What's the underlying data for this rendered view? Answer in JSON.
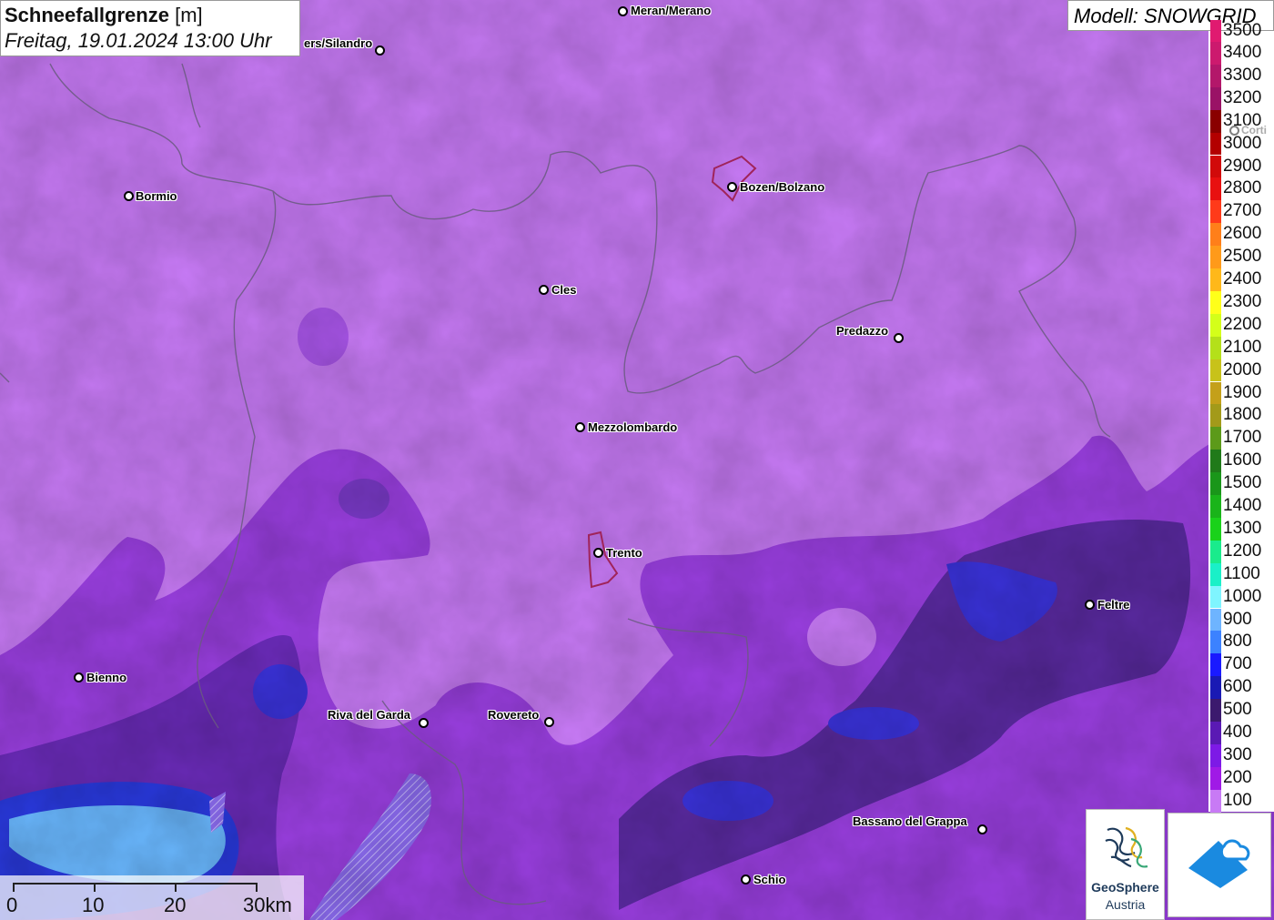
{
  "header": {
    "title_bold": "Schneefallgrenze",
    "title_unit": "[m]",
    "datetime": "Freitag, 19.01.2024 13:00 Uhr"
  },
  "model_label": "Modell: SNOWGRID",
  "legend": {
    "top_label_partial": "3500",
    "items": [
      {
        "label": "3400",
        "color": "#cc1a6e"
      },
      {
        "label": "3300",
        "color": "#b3176a"
      },
      {
        "label": "3200",
        "color": "#9a1266"
      },
      {
        "label": "3100",
        "color": "#8a0000"
      },
      {
        "label": "3000",
        "color": "#b30000"
      },
      {
        "label": "2900",
        "color": "#d10a0a"
      },
      {
        "label": "2800",
        "color": "#e81010"
      },
      {
        "label": "2700",
        "color": "#ff3a1a"
      },
      {
        "label": "2600",
        "color": "#ff7f1a"
      },
      {
        "label": "2500",
        "color": "#ff9a1a"
      },
      {
        "label": "2400",
        "color": "#ffb81a"
      },
      {
        "label": "2300",
        "color": "#ffff1a"
      },
      {
        "label": "2200",
        "color": "#d4ff1a"
      },
      {
        "label": "2100",
        "color": "#b4e01a"
      },
      {
        "label": "2000",
        "color": "#c8c21a"
      },
      {
        "label": "1900",
        "color": "#c4a01a"
      },
      {
        "label": "1800",
        "color": "#a39a1a"
      },
      {
        "label": "1700",
        "color": "#5c9a1a"
      },
      {
        "label": "1600",
        "color": "#207a1a"
      },
      {
        "label": "1500",
        "color": "#1a961a"
      },
      {
        "label": "1400",
        "color": "#1ab41a"
      },
      {
        "label": "1300",
        "color": "#1ad21a"
      },
      {
        "label": "1200",
        "color": "#1aeb8c"
      },
      {
        "label": "1100",
        "color": "#1af0c8"
      },
      {
        "label": "1000",
        "color": "#7ff5ff"
      },
      {
        "label": "900",
        "color": "#6eb4ff"
      },
      {
        "label": "800",
        "color": "#3c82ff"
      },
      {
        "label": "700",
        "color": "#1a1aff"
      },
      {
        "label": "600",
        "color": "#1a1ab4"
      },
      {
        "label": "500",
        "color": "#3c1a6e"
      },
      {
        "label": "400",
        "color": "#5a1ab4"
      },
      {
        "label": "300",
        "color": "#7d1ae6"
      },
      {
        "label": "200",
        "color": "#a01ae6"
      },
      {
        "label": "100",
        "color": "#c87af5"
      }
    ]
  },
  "cities": {
    "meran": "Meran/Merano",
    "schlanders": "ers/Silandro",
    "bormio": "Bormio",
    "bozen": "Bozen/Bolzano",
    "cles": "Cles",
    "predazzo": "Predazzo",
    "mezzolombardo": "Mezzolombardo",
    "trento": "Trento",
    "feltre": "Feltre",
    "bienno": "Bienno",
    "riva": "Riva del Garda",
    "rovereto": "Rovereto",
    "bassano": "Bassano del Grappa",
    "schio": "Schio",
    "cortina_partial": "Corti"
  },
  "scalebar": {
    "labels": [
      "0",
      "10",
      "20",
      "30km"
    ]
  },
  "logos": {
    "geosphere_line1": "GeoSphere",
    "geosphere_line2": "Austria"
  },
  "colors": {
    "base_purple": "#c77af5",
    "mid_purple": "#9a3fe0",
    "deep_purple": "#6a2bb8",
    "blue": "#3a32d8",
    "light_blue": "#6ab8ff",
    "city_outline": "#a0245a"
  }
}
